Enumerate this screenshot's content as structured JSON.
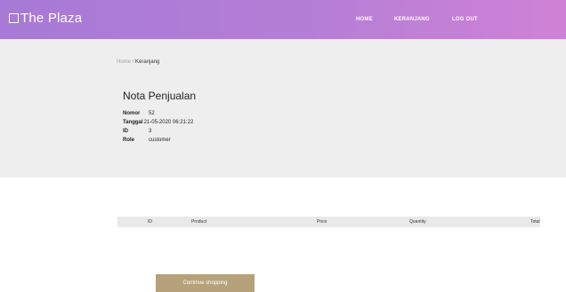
{
  "navbar": {
    "brand": "The Plaza",
    "brand_icon": "square-outline-icon",
    "items": [
      {
        "label": "HOME"
      },
      {
        "label": "KERANJANG"
      },
      {
        "label": "LOG OUT"
      }
    ],
    "gradient_colors": [
      "#a67ad6",
      "#cf82d6"
    ]
  },
  "breadcrumb": {
    "home": "Home",
    "separator": "/",
    "current": "Keranjang"
  },
  "invoice": {
    "title": "Nota Penjualan",
    "fields": [
      {
        "label": "Nomor",
        "value": "52"
      },
      {
        "label": "Tanggal",
        "value": "21-05-2020 06:21:22"
      },
      {
        "label": "ID",
        "value": "3"
      },
      {
        "label": "Role",
        "value": "customer"
      }
    ]
  },
  "table": {
    "columns": [
      "ID",
      "Product",
      "Price",
      "Quantity",
      "Total"
    ]
  },
  "actions": {
    "continue_label": "Continue shopping",
    "continue_color": "#b5a27b"
  }
}
